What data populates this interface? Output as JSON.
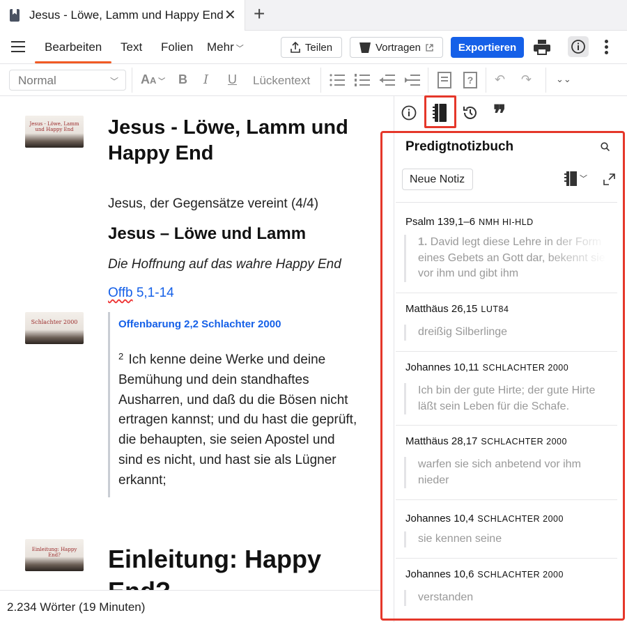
{
  "tab": {
    "title": "Jesus - Löwe, Lamm und Happy End"
  },
  "menu": {
    "items": [
      "Bearbeiten",
      "Text",
      "Folien",
      "Mehr"
    ],
    "teilen": "Teilen",
    "vortragen": "Vortragen",
    "exportieren": "Exportieren"
  },
  "toolbar": {
    "style": "Normal",
    "cloze": "Lückentext"
  },
  "doc": {
    "title": "Jesus - Löwe, Lamm und Happy End",
    "thumb1": "Jesus - Löwe, Lamm und Happy End",
    "series": "Jesus, der Gegensätze vereint (4/4)",
    "heading2": "Jesus – Löwe und Lamm",
    "subtitle": "Die Hoffnung auf das wahre Happy End",
    "ref_book": "Offb",
    "ref_rest": " 5,1-14",
    "thumb2": "Schlachter 2000",
    "quote_title": "Offenbarung 2,2 Schlachter 2000",
    "quote_verse_no": "2",
    "quote_text": "Ich kenne deine Werke und deine Bemühung und dein standhaftes Ausharren, und daß du die Bösen nicht ertragen kannst; und du hast die geprüft, die behaupten, sie seien Apostel und sind es nicht, und hast sie als Lügner erkannt;",
    "thumb3": "Einleitung: Happy End?",
    "heading3": "Einleitung: Happy End?"
  },
  "status": {
    "words": "2.234 Wörter (19 Minuten)"
  },
  "panel": {
    "title": "Predigtnotizbuch",
    "new_note": "Neue Notiz",
    "notes": [
      {
        "ref": "Psalm 139,1–6",
        "version": "NMH HI-HLD",
        "num": "1.",
        "text": "David legt diese Lehre in der Form eines Gebets an Gott dar, bekennt sie vor ihm und gibt ihm"
      },
      {
        "ref": "Matthäus 26,15",
        "version": "LUT84",
        "text": "dreißig Silberlinge"
      },
      {
        "ref": "Johannes 10,11",
        "version": "SCHLACHTER 2000",
        "text": "Ich bin der gute Hirte; der gute Hirte läßt sein Leben für die Schafe."
      },
      {
        "ref": "Matthäus 28,17",
        "version": "SCHLACHTER 2000",
        "text": "warfen sie sich anbetend vor ihm nieder"
      },
      {
        "ref": "Johannes 10,4",
        "version": "SCHLACHTER 2000",
        "text": "sie kennen seine"
      },
      {
        "ref": "Johannes 10,6",
        "version": "SCHLACHTER 2000",
        "text": "verstanden"
      }
    ]
  },
  "colors": {
    "accent": "#1560e8",
    "active_tab_underline": "#f15a24",
    "highlight_box": "#e5372a"
  }
}
